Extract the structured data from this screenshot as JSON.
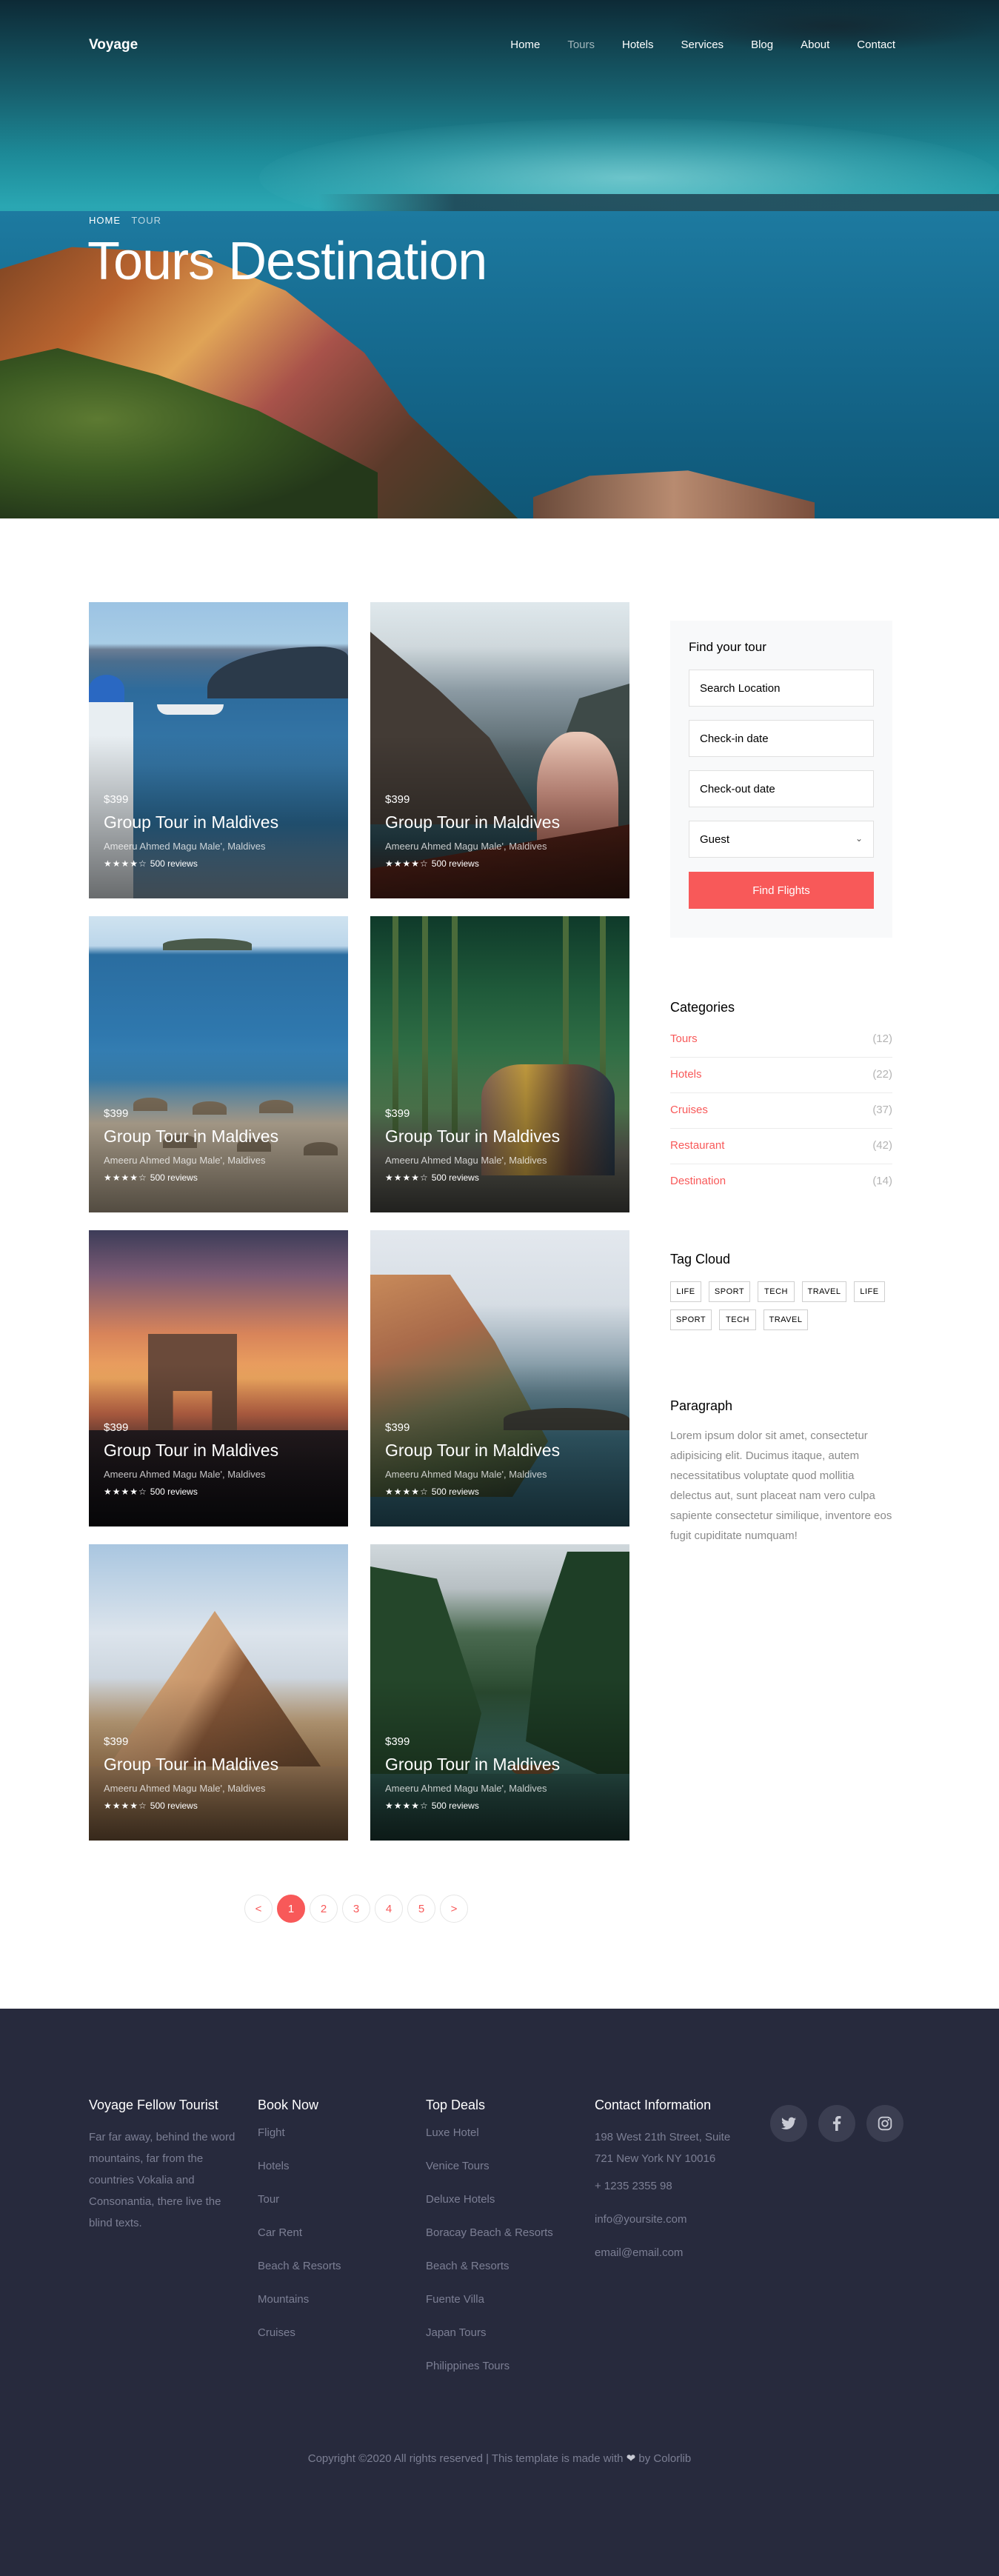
{
  "brand": "Voyage",
  "nav": [
    {
      "label": "Home",
      "active": false
    },
    {
      "label": "Tours",
      "active": true
    },
    {
      "label": "Hotels",
      "active": false
    },
    {
      "label": "Services",
      "active": false
    },
    {
      "label": "Blog",
      "active": false
    },
    {
      "label": "About",
      "active": false
    },
    {
      "label": "Contact",
      "active": false
    }
  ],
  "breadcrumb": {
    "home": "HOME",
    "current": "TOUR"
  },
  "hero_title": "Tours Destination",
  "tours": [
    {
      "price": "$399",
      "title": "Group Tour in Maldives",
      "location": "Ameeru Ahmed Magu Male', Maldives",
      "stars": "★★★★☆",
      "reviews": "500 reviews"
    },
    {
      "price": "$399",
      "title": "Group Tour in Maldives",
      "location": "Ameeru Ahmed Magu Male', Maldives",
      "stars": "★★★★☆",
      "reviews": "500 reviews"
    },
    {
      "price": "$399",
      "title": "Group Tour in Maldives",
      "location": "Ameeru Ahmed Magu Male', Maldives",
      "stars": "★★★★☆",
      "reviews": "500 reviews"
    },
    {
      "price": "$399",
      "title": "Group Tour in Maldives",
      "location": "Ameeru Ahmed Magu Male', Maldives",
      "stars": "★★★★☆",
      "reviews": "500 reviews"
    },
    {
      "price": "$399",
      "title": "Group Tour in Maldives",
      "location": "Ameeru Ahmed Magu Male', Maldives",
      "stars": "★★★★☆",
      "reviews": "500 reviews"
    },
    {
      "price": "$399",
      "title": "Group Tour in Maldives",
      "location": "Ameeru Ahmed Magu Male', Maldives",
      "stars": "★★★★☆",
      "reviews": "500 reviews"
    },
    {
      "price": "$399",
      "title": "Group Tour in Maldives",
      "location": "Ameeru Ahmed Magu Male', Maldives",
      "stars": "★★★★☆",
      "reviews": "500 reviews"
    },
    {
      "price": "$399",
      "title": "Group Tour in Maldives",
      "location": "Ameeru Ahmed Magu Male', Maldives",
      "stars": "★★★★☆",
      "reviews": "500 reviews"
    }
  ],
  "pagination": {
    "prev": "<",
    "pages": [
      "1",
      "2",
      "3",
      "4",
      "5"
    ],
    "active": "1",
    "next": ">"
  },
  "search": {
    "title": "Find your tour",
    "location": "Search Location",
    "checkin": "Check-in date",
    "checkout": "Check-out date",
    "guest": "Guest",
    "button": "Find Flights"
  },
  "categories_title": "Categories",
  "categories": [
    {
      "name": "Tours",
      "count": "(12)"
    },
    {
      "name": "Hotels",
      "count": "(22)"
    },
    {
      "name": "Cruises",
      "count": "(37)"
    },
    {
      "name": "Restaurant",
      "count": "(42)"
    },
    {
      "name": "Destination",
      "count": "(14)"
    }
  ],
  "tags_title": "Tag Cloud",
  "tags": [
    "LIFE",
    "SPORT",
    "TECH",
    "TRAVEL",
    "LIFE",
    "SPORT",
    "TECH",
    "TRAVEL"
  ],
  "paragraph_title": "Paragraph",
  "paragraph": "Lorem ipsum dolor sit amet, consectetur adipisicing elit. Ducimus itaque, autem necessitatibus voluptate quod mollitia delectus aut, sunt placeat nam vero culpa sapiente consectetur similique, inventore eos fugit cupiditate numquam!",
  "footer": {
    "about_title": "Voyage Fellow Tourist",
    "about_text": "Far far away, behind the word mountains, far from the countries Vokalia and Consonantia, there live the blind texts.",
    "book_title": "Book Now",
    "book_links": [
      "Flight",
      "Hotels",
      "Tour",
      "Car Rent",
      "Beach & Resorts",
      "Mountains",
      "Cruises"
    ],
    "deals_title": "Top Deals",
    "deals_links": [
      "Luxe Hotel",
      "Venice Tours",
      "Deluxe Hotels",
      "Boracay Beach & Resorts",
      "Beach & Resorts",
      "Fuente Villa",
      "Japan Tours",
      "Philippines Tours"
    ],
    "contact_title": "Contact Information",
    "address": "198 West 21th Street, Suite 721 New York NY 10016",
    "phone": "+ 1235 2355 98",
    "email1": "info@yoursite.com",
    "email2": "email@email.com",
    "social": [
      "twitter-icon",
      "facebook-icon",
      "instagram-icon"
    ],
    "copyright_pre": "Copyright ©2020 All rights reserved | This template is made with",
    "copyright_post": "by Colorlib"
  },
  "colors": {
    "accent": "#f85959",
    "footer_bg": "#272a3d",
    "footer_text": "#7c7f94"
  }
}
